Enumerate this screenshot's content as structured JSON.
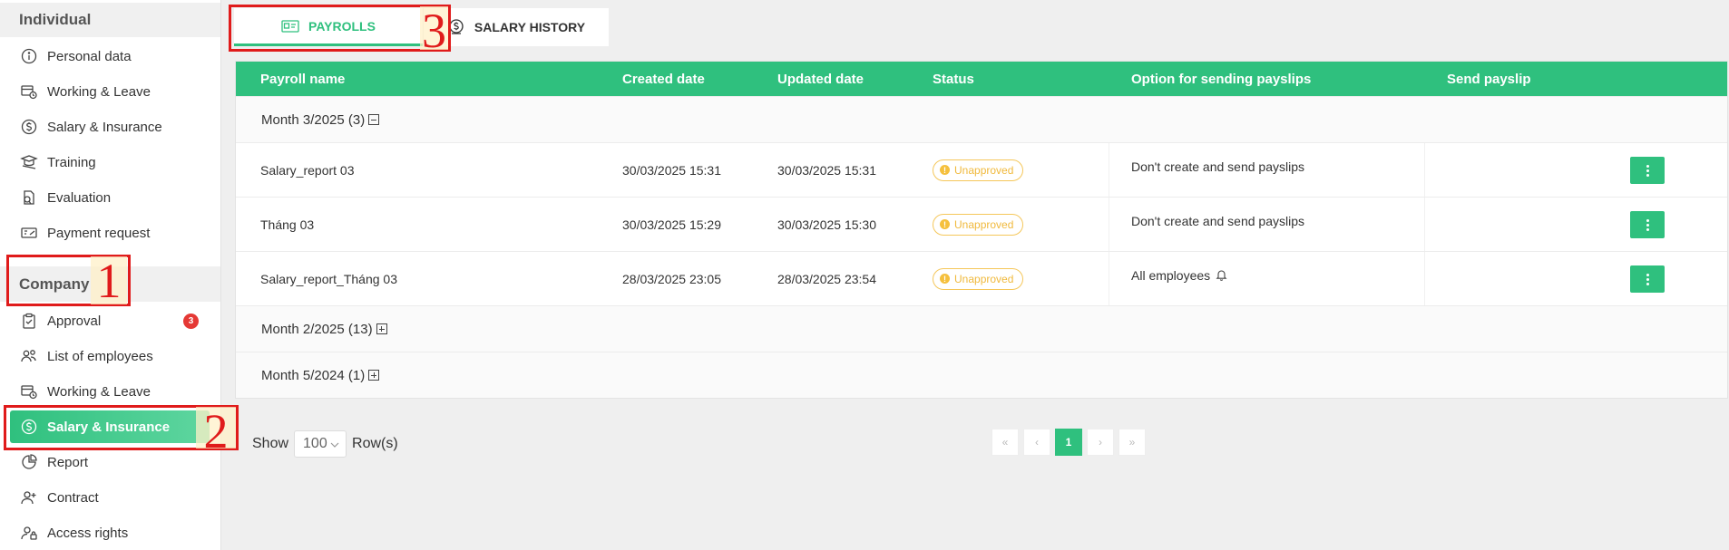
{
  "sidebar": {
    "individual_heading": "Individual",
    "individual_items": [
      {
        "label": "Personal data",
        "icon": "info-circle-icon"
      },
      {
        "label": "Working & Leave",
        "icon": "calendar-clock-icon"
      },
      {
        "label": "Salary & Insurance",
        "icon": "dollar-circle-icon"
      },
      {
        "label": "Training",
        "icon": "training-icon"
      },
      {
        "label": "Evaluation",
        "icon": "evaluation-icon"
      },
      {
        "label": "Payment request",
        "icon": "payment-request-icon"
      }
    ],
    "company_heading": "Company",
    "company_items": [
      {
        "label": "Approval",
        "icon": "clipboard-check-icon",
        "badge": "3"
      },
      {
        "label": "List of employees",
        "icon": "users-icon"
      },
      {
        "label": "Working & Leave",
        "icon": "calendar-clock-icon"
      },
      {
        "label": "Salary & Insurance",
        "icon": "dollar-circle-icon",
        "active": true
      },
      {
        "label": "Report",
        "icon": "pie-chart-icon"
      },
      {
        "label": "Contract",
        "icon": "add-user-icon"
      },
      {
        "label": "Access rights",
        "icon": "user-lock-icon"
      }
    ]
  },
  "annotations": [
    "1",
    "2",
    "3"
  ],
  "tabs": {
    "payrolls": "PAYROLLS",
    "salary_history": "SALARY HISTORY"
  },
  "table": {
    "headers": [
      "Payroll name",
      "Created date",
      "Updated date",
      "Status",
      "Option for sending payslips",
      "Send payslip"
    ],
    "groups": [
      {
        "label": "Month 3/2025 (3)",
        "expanded": true,
        "rows": [
          {
            "name": "Salary_report 03",
            "created": "30/03/2025 15:31",
            "updated": "30/03/2025 15:31",
            "status": "Unapproved",
            "option": "Don't create and send payslips"
          },
          {
            "name": "Tháng 03",
            "created": "30/03/2025 15:29",
            "updated": "30/03/2025 15:30",
            "status": "Unapproved",
            "option": "Don't create and send payslips"
          },
          {
            "name": "Salary_report_Tháng 03",
            "created": "28/03/2025 23:05",
            "updated": "28/03/2025 23:54",
            "status": "Unapproved",
            "option": "All employees"
          }
        ]
      },
      {
        "label": "Month 2/2025 (13)",
        "expanded": false
      },
      {
        "label": "Month 5/2024 (1)",
        "expanded": false
      }
    ]
  },
  "footer": {
    "show_label": "Show",
    "rows_value": "100",
    "rows_label": "Row(s)",
    "pager": {
      "first": "«",
      "prev": "‹",
      "current": "1",
      "next": "›",
      "last": "»"
    }
  },
  "colors": {
    "accent": "#2fc07e",
    "status_warning": "#f5c03d",
    "annotation_red": "#e01b1b",
    "badge_red": "#e53935"
  }
}
